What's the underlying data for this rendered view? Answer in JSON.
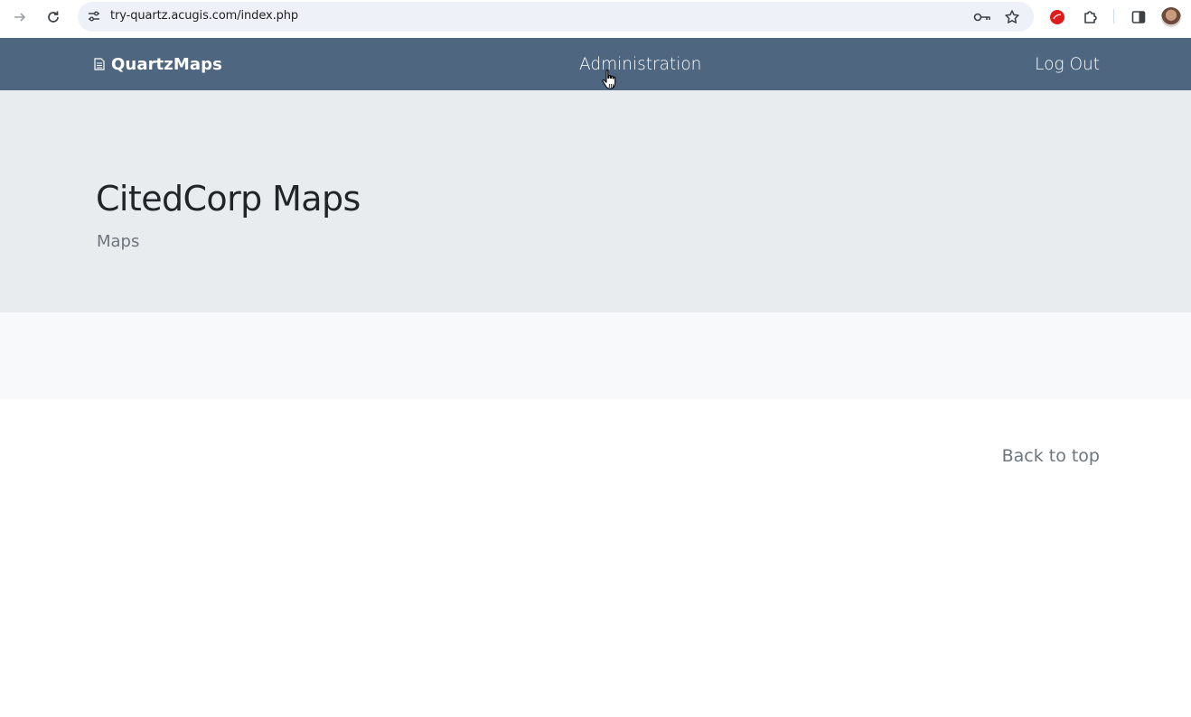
{
  "browser": {
    "url": "try-quartz.acugis.com/index.php",
    "icons": [
      "forward-icon",
      "reload-icon",
      "site-info-icon",
      "password-key-icon",
      "bookmark-star-icon",
      "extension-red-icon",
      "extensions-puzzle-icon",
      "side-panel-icon",
      "profile-avatar"
    ]
  },
  "navbar": {
    "brand": "QuartzMaps",
    "brand_icon": "document-icon",
    "links": [
      {
        "label": "Administration"
      },
      {
        "label": "Log Out"
      }
    ],
    "background": "#4f6680"
  },
  "hero": {
    "title": "CitedCorp Maps",
    "subtitle": "Maps",
    "background": "#e9ecef"
  },
  "footer": {
    "back_to_top": "Back to top"
  }
}
